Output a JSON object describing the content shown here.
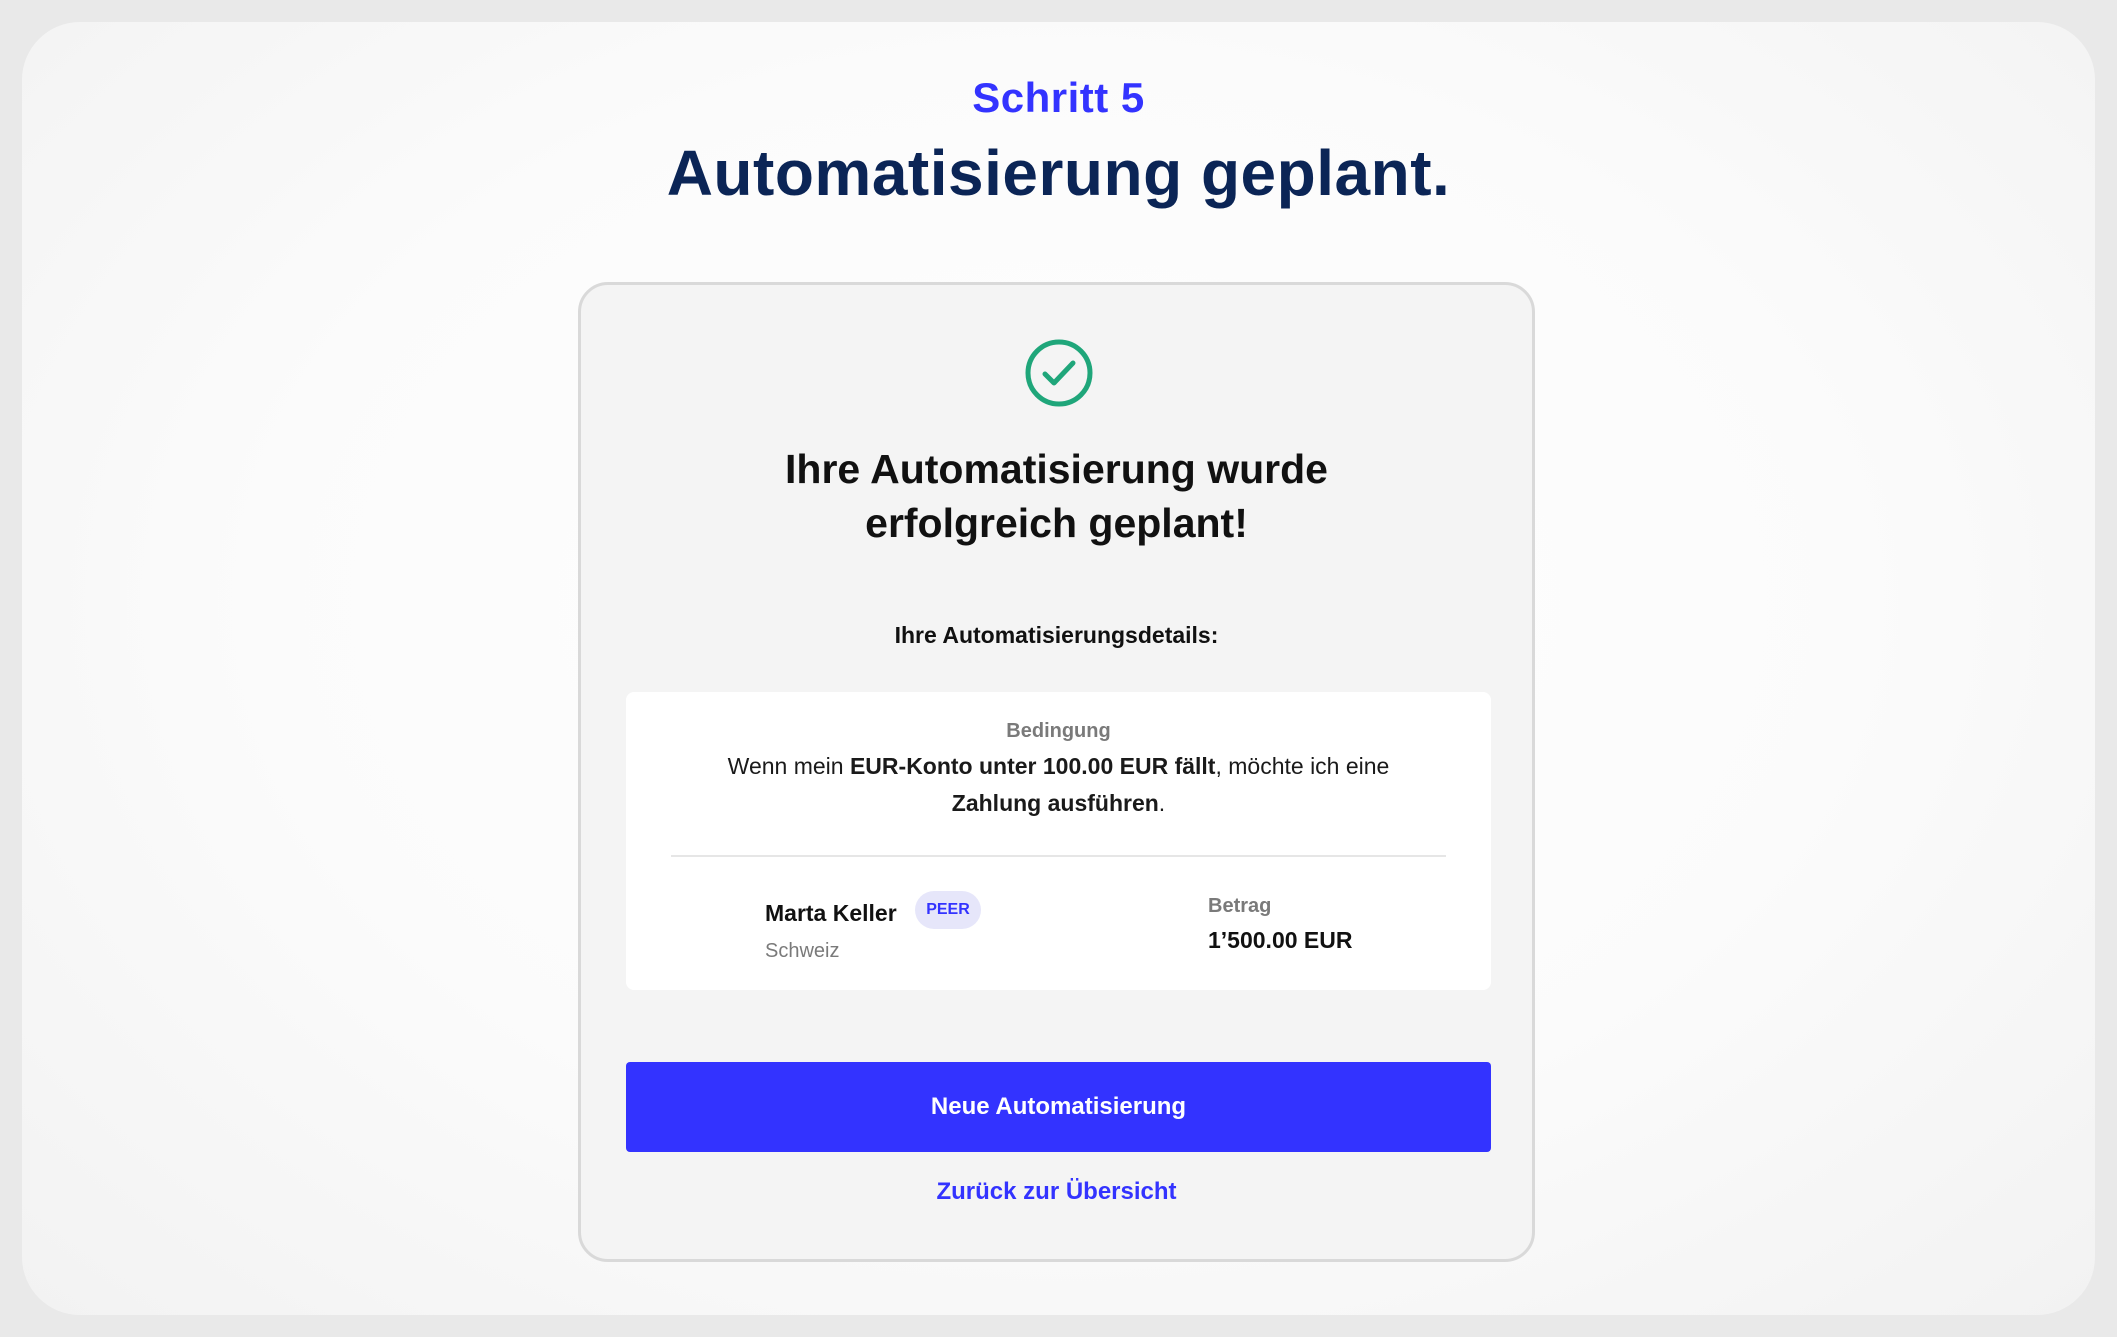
{
  "header": {
    "step_label": "Schritt 5",
    "title": "Automatisierung geplant."
  },
  "card": {
    "icon": "check-circle-icon",
    "heading_line1": "Ihre Automatisierung wurde",
    "heading_line2": "erfolgreich geplant!",
    "details_heading": "Ihre Automatisierungsdetails:"
  },
  "condition": {
    "label": "Bedingung",
    "text_part1": "Wenn mein ",
    "text_bold1": "EUR-Konto unter 100.00 EUR fällt",
    "text_part2": ", möchte ich eine ",
    "text_bold2": "Zahlung ausführen",
    "text_part3": "."
  },
  "recipient": {
    "name": "Marta Keller",
    "badge": "PEER",
    "country": "Schweiz"
  },
  "amount": {
    "label": "Betrag",
    "value": "1’500.00 EUR"
  },
  "actions": {
    "primary_label": "Neue Automatisierung",
    "back_link_label": "Zurück zur Übersicht"
  },
  "colors": {
    "accent": "#3333ff",
    "title": "#0b2556",
    "success": "#1fa67a"
  }
}
